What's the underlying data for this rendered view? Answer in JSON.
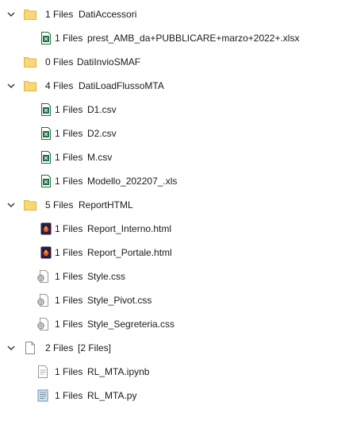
{
  "tree": {
    "items": [
      {
        "count": "1 Files",
        "label": "DatiAccessori",
        "icon": "folder-icon",
        "expanded": true
      },
      {
        "count": "1 Files",
        "label": "prest_AMB_da+PUBBLICARE+marzo+2022+.xlsx",
        "icon": "excel-file-icon"
      },
      {
        "count": "0 Files",
        "label": "DatiInvioSMAF",
        "icon": "folder-icon",
        "expanded": false
      },
      {
        "count": "4 Files",
        "label": "DatiLoadFlussoMTA",
        "icon": "folder-icon",
        "expanded": true
      },
      {
        "count": "1 Files",
        "label": "D1.csv",
        "icon": "csv-file-icon"
      },
      {
        "count": "1 Files",
        "label": "D2.csv",
        "icon": "csv-file-icon"
      },
      {
        "count": "1 Files",
        "label": "M.csv",
        "icon": "csv-file-icon"
      },
      {
        "count": "1 Files",
        "label": "Modello_202207_.xls",
        "icon": "excel-file-icon"
      },
      {
        "count": "5 Files",
        "label": "ReportHTML",
        "icon": "folder-icon",
        "expanded": true
      },
      {
        "count": "1 Files",
        "label": "Report_Interno.html",
        "icon": "html-file-icon"
      },
      {
        "count": "1 Files",
        "label": "Report_Portale.html",
        "icon": "html-file-icon"
      },
      {
        "count": "1 Files",
        "label": "Style.css",
        "icon": "css-file-icon"
      },
      {
        "count": "1 Files",
        "label": "Style_Pivot.css",
        "icon": "css-file-icon"
      },
      {
        "count": "1 Files",
        "label": "Style_Segreteria.css",
        "icon": "css-file-icon"
      },
      {
        "count": "2 Files",
        "label": "[2 Files]",
        "icon": "blank-file-icon",
        "expanded": true
      },
      {
        "count": "1 Files",
        "label": "RL_MTA.ipynb",
        "icon": "notebook-file-icon"
      },
      {
        "count": "1 Files",
        "label": "RL_MTA.py",
        "icon": "python-file-icon"
      }
    ]
  },
  "colors": {
    "folder": "#F8D775",
    "folder_dark": "#E0B440",
    "excel": "#1D6F42",
    "html": "#C7351F"
  }
}
